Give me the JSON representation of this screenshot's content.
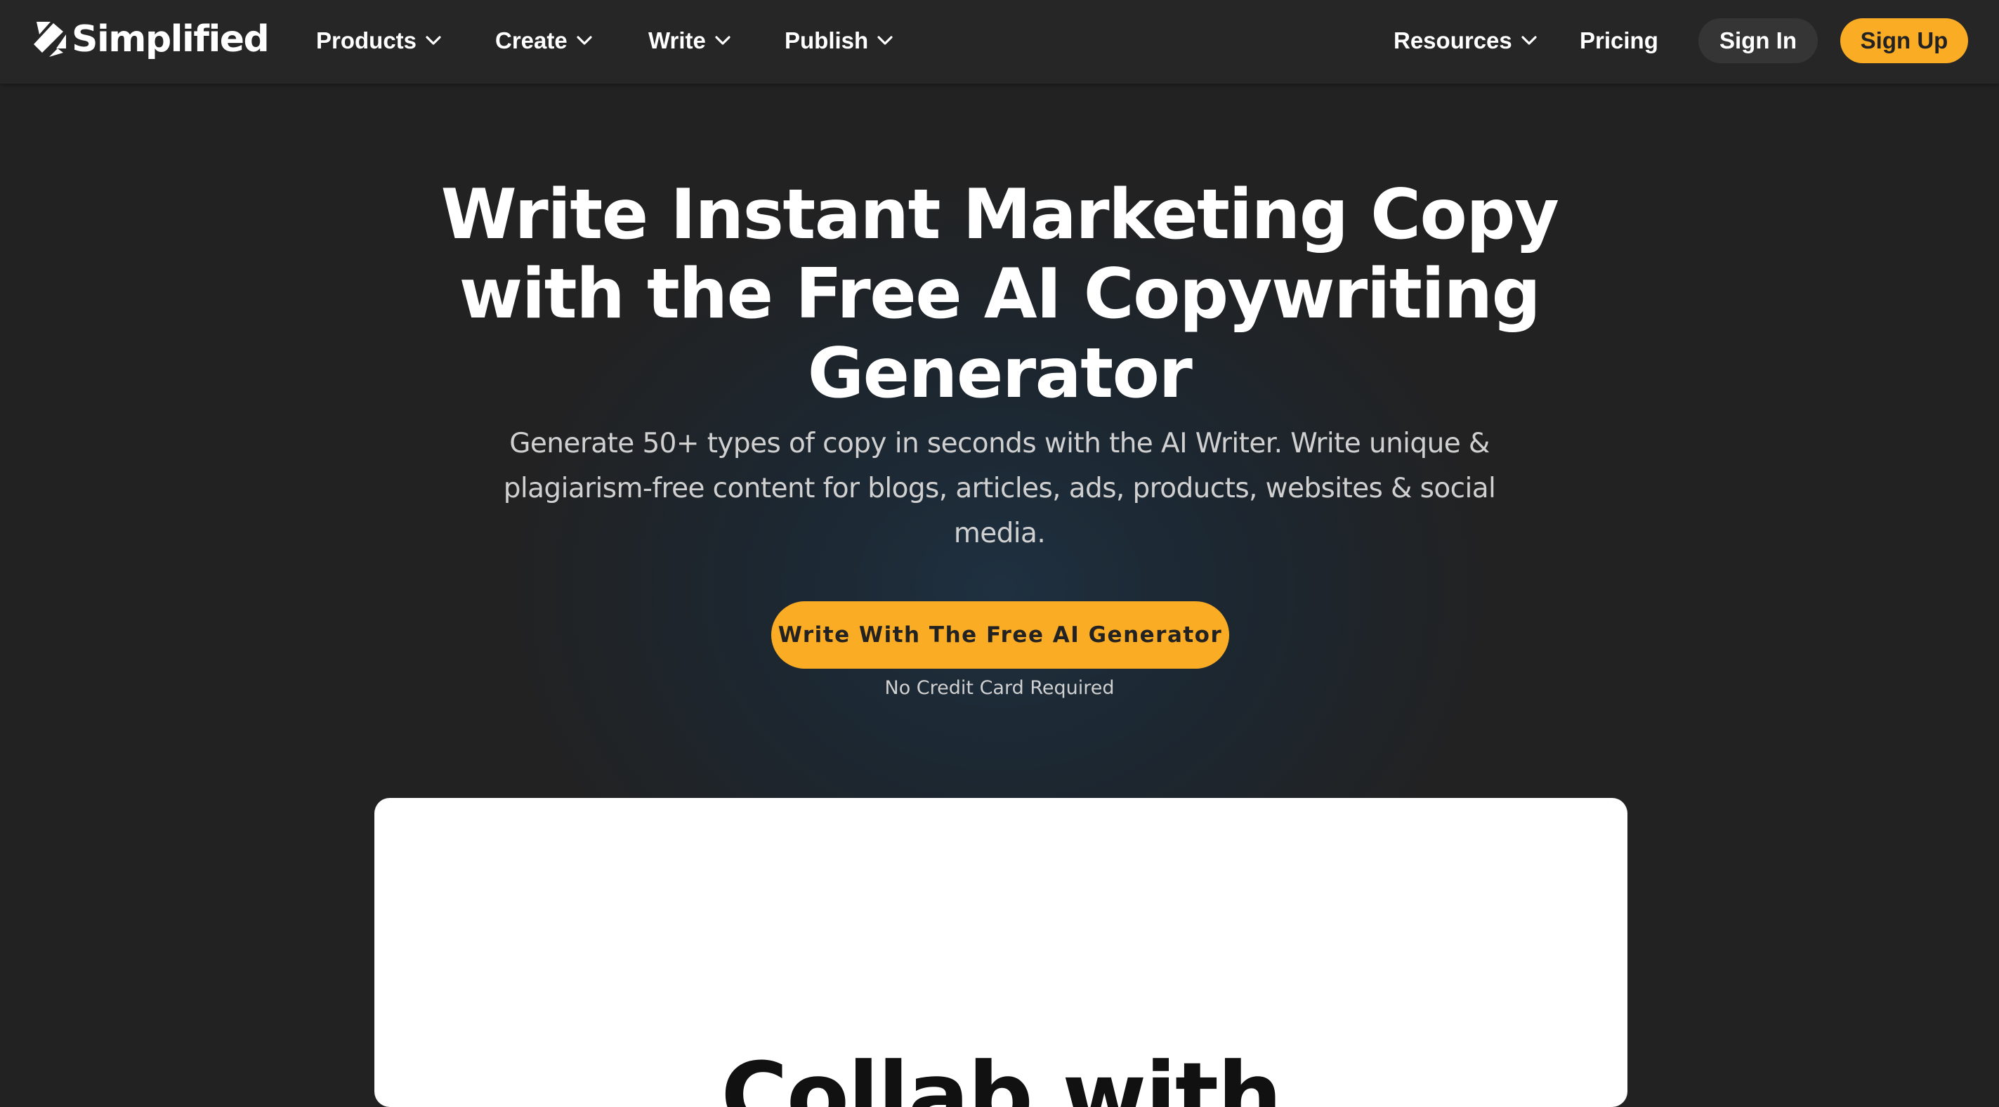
{
  "brand": {
    "name": "Simplified",
    "accent": "#fbac25",
    "background": "#222222"
  },
  "nav": {
    "items": [
      {
        "label": "Products",
        "icon": "chevron-down-icon"
      },
      {
        "label": "Create",
        "icon": "chevron-down-icon"
      },
      {
        "label": "Write",
        "icon": "chevron-down-icon"
      },
      {
        "label": "Publish",
        "icon": "chevron-down-icon"
      },
      {
        "label": "Resources",
        "icon": "chevron-down-icon"
      }
    ],
    "pricing": "Pricing",
    "sign_in": "Sign In",
    "sign_up": "Sign Up"
  },
  "hero": {
    "title": "Write Instant Marketing Copy with the Free AI Copywriting Generator",
    "subtitle": "Generate 50+ types of copy in seconds with the AI Writer. Write unique & plagiarism-free content for blogs, articles, ads, products, websites & social media.",
    "cta": "Write With The Free AI Generator",
    "cta_note": "No Credit Card Required"
  },
  "card": {
    "heading": "Collab with"
  }
}
